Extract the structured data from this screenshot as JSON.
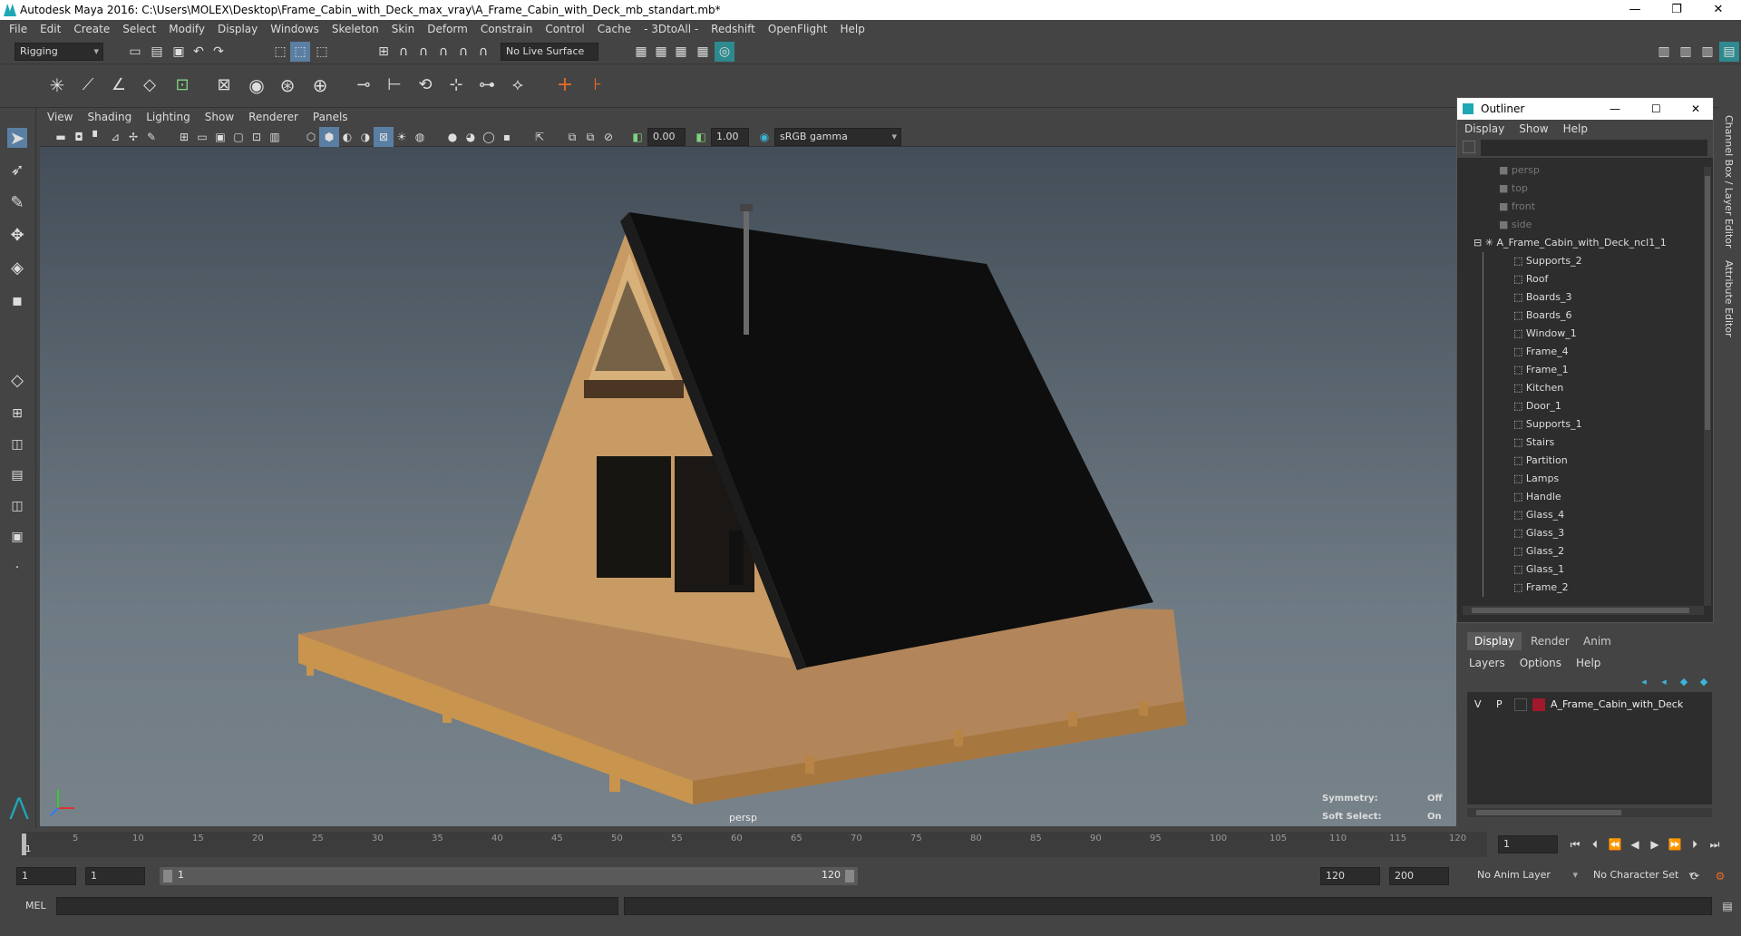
{
  "window": {
    "title": "Autodesk Maya 2016: C:\\Users\\MOLEX\\Desktop\\Frame_Cabin_with_Deck_max_vray\\A_Frame_Cabin_with_Deck_mb_standart.mb*",
    "minimize": "—",
    "restore": "❐",
    "close": "✕"
  },
  "menubar": [
    "File",
    "Edit",
    "Create",
    "Select",
    "Modify",
    "Display",
    "Windows",
    "Skeleton",
    "Skin",
    "Deform",
    "Constrain",
    "Control",
    "Cache",
    "- 3DtoAll -",
    "Redshift",
    "OpenFlight",
    "Help"
  ],
  "statusline": {
    "mode": "Rigging",
    "live_surface": "No Live Surface"
  },
  "viewport": {
    "menu": [
      "View",
      "Shading",
      "Lighting",
      "Show",
      "Renderer",
      "Panels"
    ],
    "exposure": "0.00",
    "gamma": "1.00",
    "colorspace": "sRGB gamma",
    "camera_label": "persp",
    "symmetry_label": "Symmetry:",
    "symmetry_value": "Off",
    "soft_select_label": "Soft Select:",
    "soft_select_value": "On"
  },
  "outliner": {
    "title": "Outliner",
    "menu": [
      "Display",
      "Show",
      "Help"
    ],
    "cameras": [
      "persp",
      "top",
      "front",
      "side"
    ],
    "root": "A_Frame_Cabin_with_Deck_ncl1_1",
    "children": [
      "Supports_2",
      "Roof",
      "Boards_3",
      "Boards_6",
      "Window_1",
      "Frame_4",
      "Frame_1",
      "Kitchen",
      "Door_1",
      "Supports_1",
      "Stairs",
      "Partition",
      "Lamps",
      "Handle",
      "Glass_4",
      "Glass_3",
      "Glass_2",
      "Glass_1",
      "Frame_2"
    ]
  },
  "layers": {
    "tabs": [
      "Display",
      "Render",
      "Anim"
    ],
    "menu": [
      "Layers",
      "Options",
      "Help"
    ],
    "layer": {
      "v": "V",
      "p": "P",
      "name": "A_Frame_Cabin_with_Deck",
      "color": "#a0182a"
    }
  },
  "sidestrip": {
    "channel_box": "Channel Box / Layer Editor",
    "attribute_editor": "Attribute Editor"
  },
  "timeline": {
    "ticks": [
      "5",
      "10",
      "15",
      "20",
      "25",
      "30",
      "35",
      "40",
      "45",
      "50",
      "55",
      "60",
      "65",
      "70",
      "75",
      "80",
      "85",
      "90",
      "95",
      "100",
      "105",
      "110",
      "115",
      "120"
    ],
    "start_marker": "1",
    "current_frame": "1"
  },
  "range": {
    "start": "1",
    "playback_start": "1",
    "slider_start": "1",
    "slider_end": "120",
    "playback_end": "120",
    "end": "200",
    "anim_layer": "No Anim Layer",
    "character_set": "No Character Set"
  },
  "cmdline": {
    "label": "MEL"
  }
}
